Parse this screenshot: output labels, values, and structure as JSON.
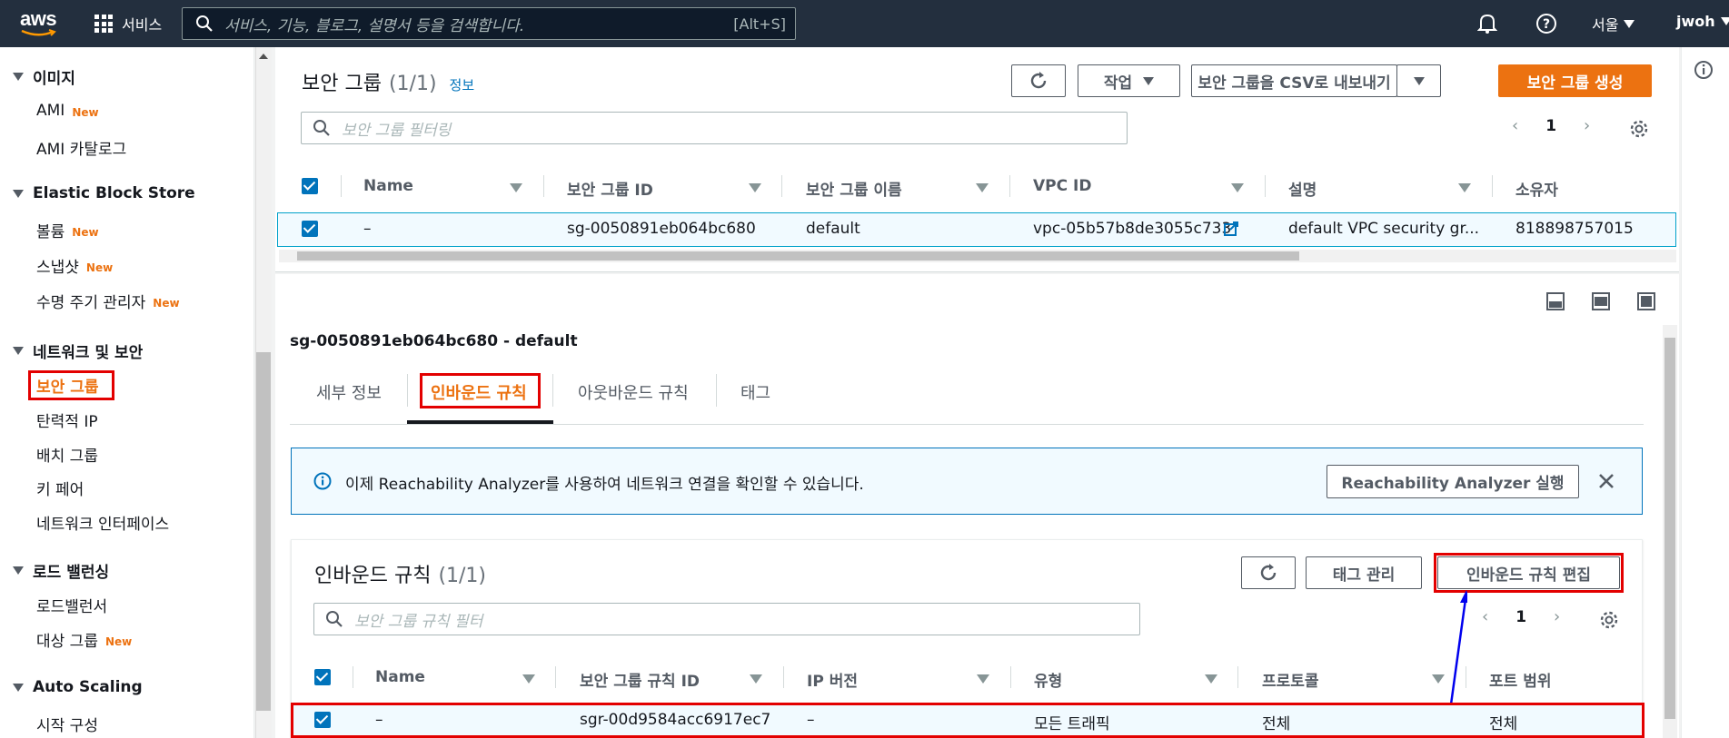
{
  "topnav": {
    "logo": "aws",
    "services_label": "서비스",
    "search_placeholder": "서비스, 기능, 블로그, 설명서 등을 검색합니다.",
    "search_shortcut": "[Alt+S]",
    "region": "서울",
    "user": "jwoh"
  },
  "sidebar": {
    "sections": [
      {
        "title": "이미지",
        "items": [
          {
            "label": "AMI",
            "new": "New"
          },
          {
            "label": "AMI 카탈로그",
            "new": ""
          }
        ]
      },
      {
        "title": "Elastic Block Store",
        "items": [
          {
            "label": "볼륨",
            "new": "New"
          },
          {
            "label": "스냅샷",
            "new": "New"
          },
          {
            "label": "수명 주기 관리자",
            "new": "New"
          }
        ]
      },
      {
        "title": "네트워크 및 보안",
        "items": [
          {
            "label": "보안 그룹",
            "new": ""
          },
          {
            "label": "탄력적 IP",
            "new": ""
          },
          {
            "label": "배치 그룹",
            "new": ""
          },
          {
            "label": "키 페어",
            "new": ""
          },
          {
            "label": "네트워크 인터페이스",
            "new": ""
          }
        ]
      },
      {
        "title": "로드 밸런싱",
        "items": [
          {
            "label": "로드밸런서",
            "new": ""
          },
          {
            "label": "대상 그룹",
            "new": "New"
          }
        ]
      },
      {
        "title": "Auto Scaling",
        "items": [
          {
            "label": "시작 구성",
            "new": ""
          }
        ]
      }
    ]
  },
  "sg_panel": {
    "title": "보안 그룹",
    "count": "(1/1)",
    "info_link": "정보",
    "action_label": "작업",
    "export_label": "보안 그룹을 CSV로 내보내기",
    "create_label": "보안 그룹 생성",
    "filter_placeholder": "보안 그룹 필터링",
    "page": "1",
    "columns": [
      "Name",
      "보안 그룹 ID",
      "보안 그룹 이름",
      "VPC ID",
      "설명",
      "소유자"
    ],
    "row": {
      "name": "–",
      "id": "sg-0050891eb064bc680",
      "group_name": "default",
      "vpc": "vpc-05b57b8de3055c733",
      "desc": "default VPC security gr...",
      "owner": "818898757015"
    }
  },
  "detail": {
    "heading": "sg-0050891eb064bc680 - default",
    "tabs": [
      "세부 정보",
      "인바운드 규칙",
      "아웃바운드 규칙",
      "태그"
    ],
    "info_prefix": "이제 Reachability Analyzer를 사용하여 네트워크 연결을 확인할 수 있습니다.",
    "analyzer_button": "Reachability Analyzer 실행"
  },
  "inbound": {
    "title": "인바운드 규칙",
    "count": "(1/1)",
    "tag_button": "태그 관리",
    "edit_button": "인바운드 규칙 편집",
    "filter_placeholder": "보안 그룹 규칙 필터",
    "page": "1",
    "columns": [
      "Name",
      "보안 그룹 규칙 ID",
      "IP 버전",
      "유형",
      "프로토콜",
      "포트 범위"
    ],
    "row": {
      "name": "–",
      "id": "sgr-00d9584acc6917ec7",
      "ip": "–",
      "type": "모든 트래픽",
      "protocol": "전체",
      "port": "전체"
    }
  },
  "colors": {
    "accent": "#ec7211",
    "link": "#0073bb",
    "highlight": "#e30000",
    "nav": "#232f3e"
  }
}
